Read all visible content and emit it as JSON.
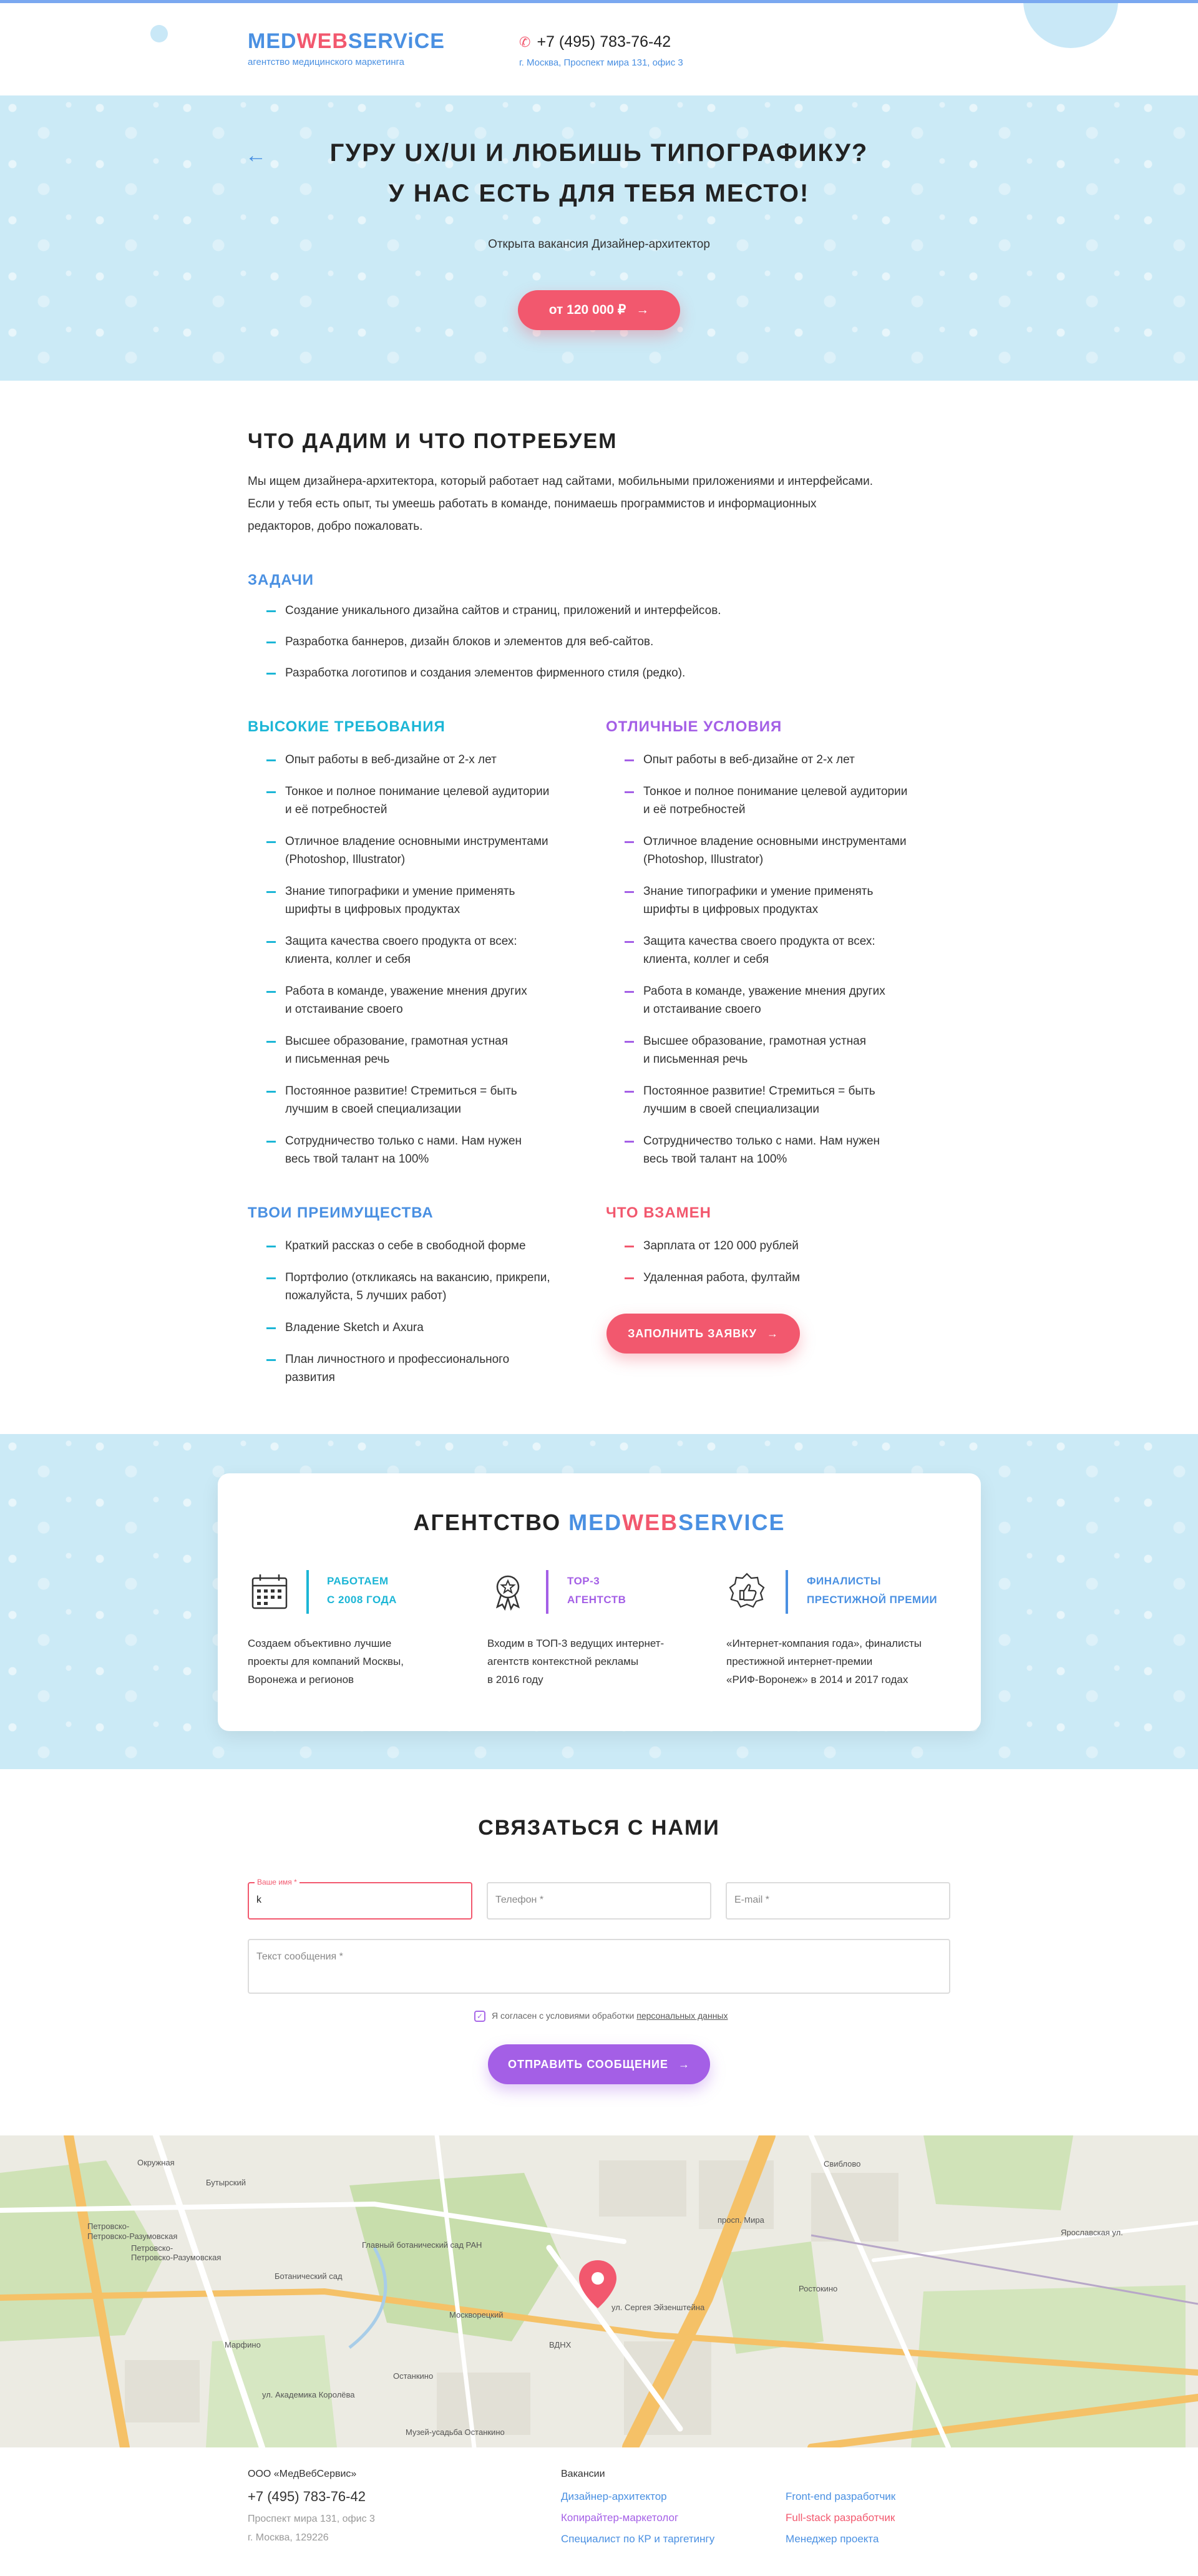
{
  "header": {
    "logo": {
      "med": "MED",
      "web": "WEB",
      "service": "SERViCE"
    },
    "logo_subtitle": "агентство медицинского маркетинга",
    "phone": "+7 (495) 783-76-42",
    "address": "г. Москва, Проспект мира 131, офис 3"
  },
  "hero": {
    "back_icon": "arrow-left-icon",
    "title_line1": "ГУРУ UX/UI И ЛЮБИШЬ ТИПОГРАФИКУ?",
    "title_line2": "У НАС ЕСТЬ ДЛЯ ТЕБЯ МЕСТО!",
    "subtitle": "Открыта вакансия Дизайнер-архитектор",
    "salary_button": "от 120 000 ₽"
  },
  "offer": {
    "title": "ЧТО ДАДИМ И ЧТО ПОТРЕБУЕМ",
    "intro_lines": [
      "Мы ищем дизайнера-архитектора, который работает над сайтами, мобильными приложениями и интерфейсами.",
      "Если у тебя есть опыт, ты умеешь работать в команде, понимаешь программистов и информационных",
      "редакторов, добро пожаловать."
    ],
    "tasks": {
      "title": "ЗАДАЧИ",
      "items": [
        "Создание уникального дизайна сайтов и страниц, приложений и интерфейсов.",
        "Разработка баннеров, дизайн блоков и элементов для веб-сайтов.",
        "Разработка логотипов и создания элементов фирменного стиля (редко)."
      ]
    },
    "requirements": {
      "title": "ВЫСОКИЕ ТРЕБОВАНИЯ",
      "items": [
        [
          "Опыт работы в веб-дизайне от 2-х лет"
        ],
        [
          "Тонкое и полное понимание целевой аудитории",
          "и её потребностей"
        ],
        [
          "Отличное владение основными инструментами",
          "(Photoshop, Illustrator)"
        ],
        [
          "Знание типографики и умение применять",
          "шрифты в цифровых продуктах"
        ],
        [
          "Защита качества своего продукта от всех:",
          "клиента, коллег и себя"
        ],
        [
          "Работа в команде, уважение мнения других",
          "и отстаивание своего"
        ],
        [
          "Высшее образование, грамотная устная",
          "и письменная речь"
        ],
        [
          "Постоянное развитие! Стремиться = быть",
          "лучшим в своей специализации"
        ],
        [
          "Сотрудничество только с нами. Нам нужен",
          "весь твой талант на 100%"
        ]
      ]
    },
    "conditions": {
      "title": "ОТЛИЧНЫЕ УСЛОВИЯ",
      "items": [
        [
          "Опыт работы в веб-дизайне от 2-х лет"
        ],
        [
          "Тонкое и полное понимание целевой аудитории",
          "и её потребностей"
        ],
        [
          "Отличное владение основными инструментами",
          "(Photoshop, Illustrator)"
        ],
        [
          "Знание типографики и умение применять",
          "шрифты в цифровых продуктах"
        ],
        [
          "Защита качества своего продукта от всех:",
          "клиента, коллег и себя"
        ],
        [
          "Работа в команде, уважение мнения других",
          "и отстаивание своего"
        ],
        [
          "Высшее образование, грамотная устная",
          "и письменная речь"
        ],
        [
          "Постоянное развитие! Стремиться = быть",
          "лучшим в своей специализации"
        ],
        [
          "Сотрудничество только с нами. Нам нужен",
          "весь твой талант на 100%"
        ]
      ]
    },
    "advantages": {
      "title": "ТВОИ ПРЕИМУЩЕСТВА",
      "items": [
        [
          "Краткий рассказ о себе в свободной форме"
        ],
        [
          "Портфолио (откликаясь на вакансию, прикрепи,",
          "пожалуйста, 5 лучших работ)"
        ],
        [
          "Владение Sketch и Axura"
        ],
        [
          "План личностного и профессионального",
          "развития"
        ]
      ]
    },
    "in_return": {
      "title": "ЧТО ВЗАМЕН",
      "items": [
        [
          "Зарплата от 120 000 рублей"
        ],
        [
          "Удаленная работа, фултайм"
        ]
      ]
    },
    "apply_button": "ЗАПОЛНИТЬ ЗАЯВКУ"
  },
  "agency": {
    "title_prefix": "АГЕНТСТВО",
    "title_med": "MED",
    "title_web": "WEB",
    "title_service": "SERVICE",
    "features": [
      {
        "icon": "calendar-icon",
        "heading": [
          "РАБОТАЕМ",
          "С 2008 ГОДА"
        ],
        "text": [
          "Создаем объективно лучшие",
          "проекты для компаний Москвы,",
          "Воронежа и регионов"
        ]
      },
      {
        "icon": "award-medal-icon",
        "heading": [
          "TOP-3",
          "АГЕНТСТВ"
        ],
        "text": [
          "Входим в ТОП-3 ведущих интернет-",
          "агентств контекстной рекламы",
          "в 2016 году"
        ]
      },
      {
        "icon": "thumbs-up-badge-icon",
        "heading": [
          "ФИНАЛИСТЫ",
          "ПРЕСТИЖНОЙ ПРЕМИИ"
        ],
        "text": [
          "«Интернет-компания года», финалисты",
          "престижной интернет-премии",
          "«РИФ-Воронеж» в 2014 и 2017 годах"
        ]
      }
    ]
  },
  "contact": {
    "title": "СВЯЗАТЬСЯ С НАМИ",
    "name_label": "Ваше имя *",
    "name_value": "k",
    "phone_placeholder": "Телефон *",
    "email_placeholder": "E-mail *",
    "message_placeholder": "Текст сообщения *",
    "consent_text": "Я согласен с условиями обработки ",
    "consent_link": "персональных данных",
    "send_button": "ОТПРАВИТЬ СООБЩЕНИЕ"
  },
  "map": {
    "labels": [
      "Окружная",
      "Петровско-Разумовская",
      "Петровско-Разумовская",
      "Главный ботанический сад РАН",
      "Ботанический сад",
      "Москворецкий",
      "ВДНХ",
      "Бутырский",
      "Марфино",
      "Останкино",
      "ул. Академика Королёва",
      "ул. Сергея Эйзенштейна",
      "просп. Мира",
      "Ростокино",
      "Свиблово",
      "Ярославская ул.",
      "Музей-усадьба Останкино"
    ],
    "pin_icon": "map-pin-icon"
  },
  "footer": {
    "company": "ООО «МедВебСервис»",
    "phone": "+7 (495) 783-76-42",
    "address_line1": "Проспект мира 131, офис 3",
    "address_line2": "г. Москва, 129226",
    "vacancies_title": "Вакансии",
    "vacancies_col1": [
      "Дизайнер-архитектор",
      "Копирайтер-маркетолог",
      "Специалист по КР и таргетингу"
    ],
    "vacancies_col2": [
      "Front-end разработчик",
      "Full-stack разработчик",
      "Менеджер проекта"
    ]
  },
  "colors": {
    "blue": "#4a90e2",
    "pink": "#f2586e",
    "cyan": "#1cb6d6",
    "purple": "#a45fe6",
    "light_bg": "#cbeaf6"
  }
}
